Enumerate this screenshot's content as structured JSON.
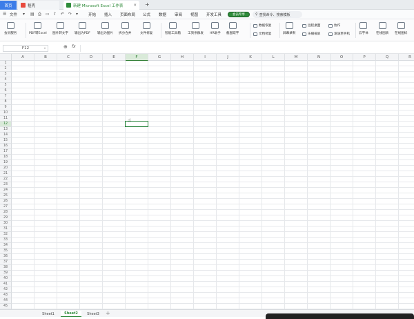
{
  "titlebar": {
    "tabs": [
      {
        "label": "首页"
      },
      {
        "label": "稻壳"
      },
      {
        "label": "新建 Microsoft Excel 工作表"
      }
    ],
    "add_tab_glyph": "+"
  },
  "menubar": {
    "file_label": "文件",
    "items": [
      "开始",
      "插入",
      "页面布局",
      "公式",
      "数据",
      "审阅",
      "视图",
      "开发工具"
    ],
    "special_badge": "会员专享",
    "search_placeholder": "查找命令、搜索模板"
  },
  "ribbon": {
    "large": [
      {
        "label": "会员服务"
      },
      {
        "label": "PDF转Excel"
      },
      {
        "label": "图片转文字"
      },
      {
        "label": "输出为PDF"
      },
      {
        "label": "输出为图片"
      },
      {
        "label": "拆分合并"
      },
      {
        "label": "文件修复"
      },
      {
        "label": "智能工具箱"
      },
      {
        "label": "工资条群发"
      },
      {
        "label": "HR助手"
      },
      {
        "label": "截图取字"
      },
      {
        "label": "屏幕录制"
      },
      {
        "label": "乐播投屏"
      },
      {
        "label": "云字体"
      },
      {
        "label": "在线图表"
      },
      {
        "label": "在线图标"
      }
    ],
    "small": [
      {
        "label": "数据恢复"
      },
      {
        "label": "文档修复"
      },
      {
        "label": "远程桌面"
      },
      {
        "label": "协作"
      },
      {
        "label": "发送至手机"
      }
    ]
  },
  "formulabar": {
    "name_box": "F12",
    "fx": "fx"
  },
  "grid": {
    "columns": [
      "A",
      "B",
      "C",
      "D",
      "E",
      "F",
      "G",
      "H",
      "I",
      "J",
      "K",
      "L",
      "M",
      "N",
      "O",
      "P",
      "Q",
      "R"
    ],
    "selected_column": "F",
    "rows": [
      "1",
      "2",
      "3",
      "4",
      "5",
      "6",
      "7",
      "8",
      "9",
      "10",
      "11",
      "12",
      "13",
      "14",
      "15",
      "16",
      "17",
      "18",
      "19",
      "20",
      "21",
      "22",
      "23",
      "24",
      "25",
      "26",
      "27",
      "28",
      "29",
      "30",
      "31",
      "32",
      "33",
      "34",
      "35",
      "36",
      "37",
      "38",
      "39",
      "40",
      "41",
      "42",
      "43",
      "44",
      "45"
    ],
    "selected_row": "12",
    "active_cell": "F12"
  },
  "sheets": {
    "tabs": [
      "Sheet1",
      "Sheet2",
      "Sheet3"
    ],
    "active": "Sheet2",
    "add_glyph": "+"
  }
}
